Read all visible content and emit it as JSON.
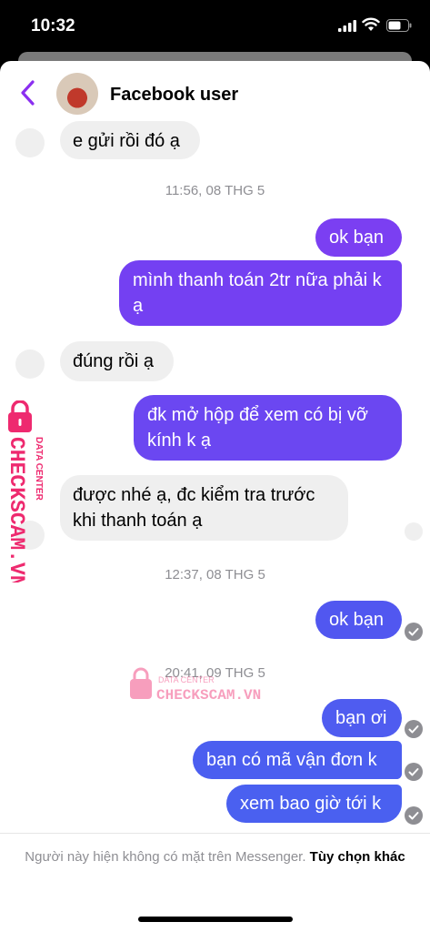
{
  "status": {
    "time": "10:32"
  },
  "header": {
    "username": "Facebook user"
  },
  "messages": [
    {
      "text": "e gửi rồi đó ạ"
    },
    {
      "text": "ok bạn"
    },
    {
      "text": "mình thanh toán 2tr nữa phải k ạ"
    },
    {
      "text": "đúng rồi ạ"
    },
    {
      "text": "đk mở hộp để xem có bị vỡ kính k ạ"
    },
    {
      "text": "được nhé ạ, đc kiểm tra trước khi thanh toán ạ"
    },
    {
      "text": "ok bạn"
    },
    {
      "text": "bạn ơi"
    },
    {
      "text": "bạn có mã vận đơn k"
    },
    {
      "text": "xem bao giờ tới k"
    }
  ],
  "timestamps": [
    "11:56, 08 THG 5",
    "12:37, 08 THG 5",
    "20:41, 09 THG 5"
  ],
  "footer": {
    "text": "Người này hiện không có mặt trên Messenger. ",
    "link": "Tùy chọn khác"
  },
  "watermark": {
    "line1": "DATA CENTER",
    "line2": "CHECKSCAM.VN"
  },
  "colors": {
    "accent": "#8b2ff0",
    "outgoing_top": "#7b3ff2",
    "outgoing_bottom": "#4f5cf0",
    "incoming": "#efefef"
  },
  "icons": [
    "back-chevron-icon",
    "seen-check-icon",
    "signal-icon",
    "wifi-icon",
    "battery-icon",
    "lock-icon"
  ]
}
